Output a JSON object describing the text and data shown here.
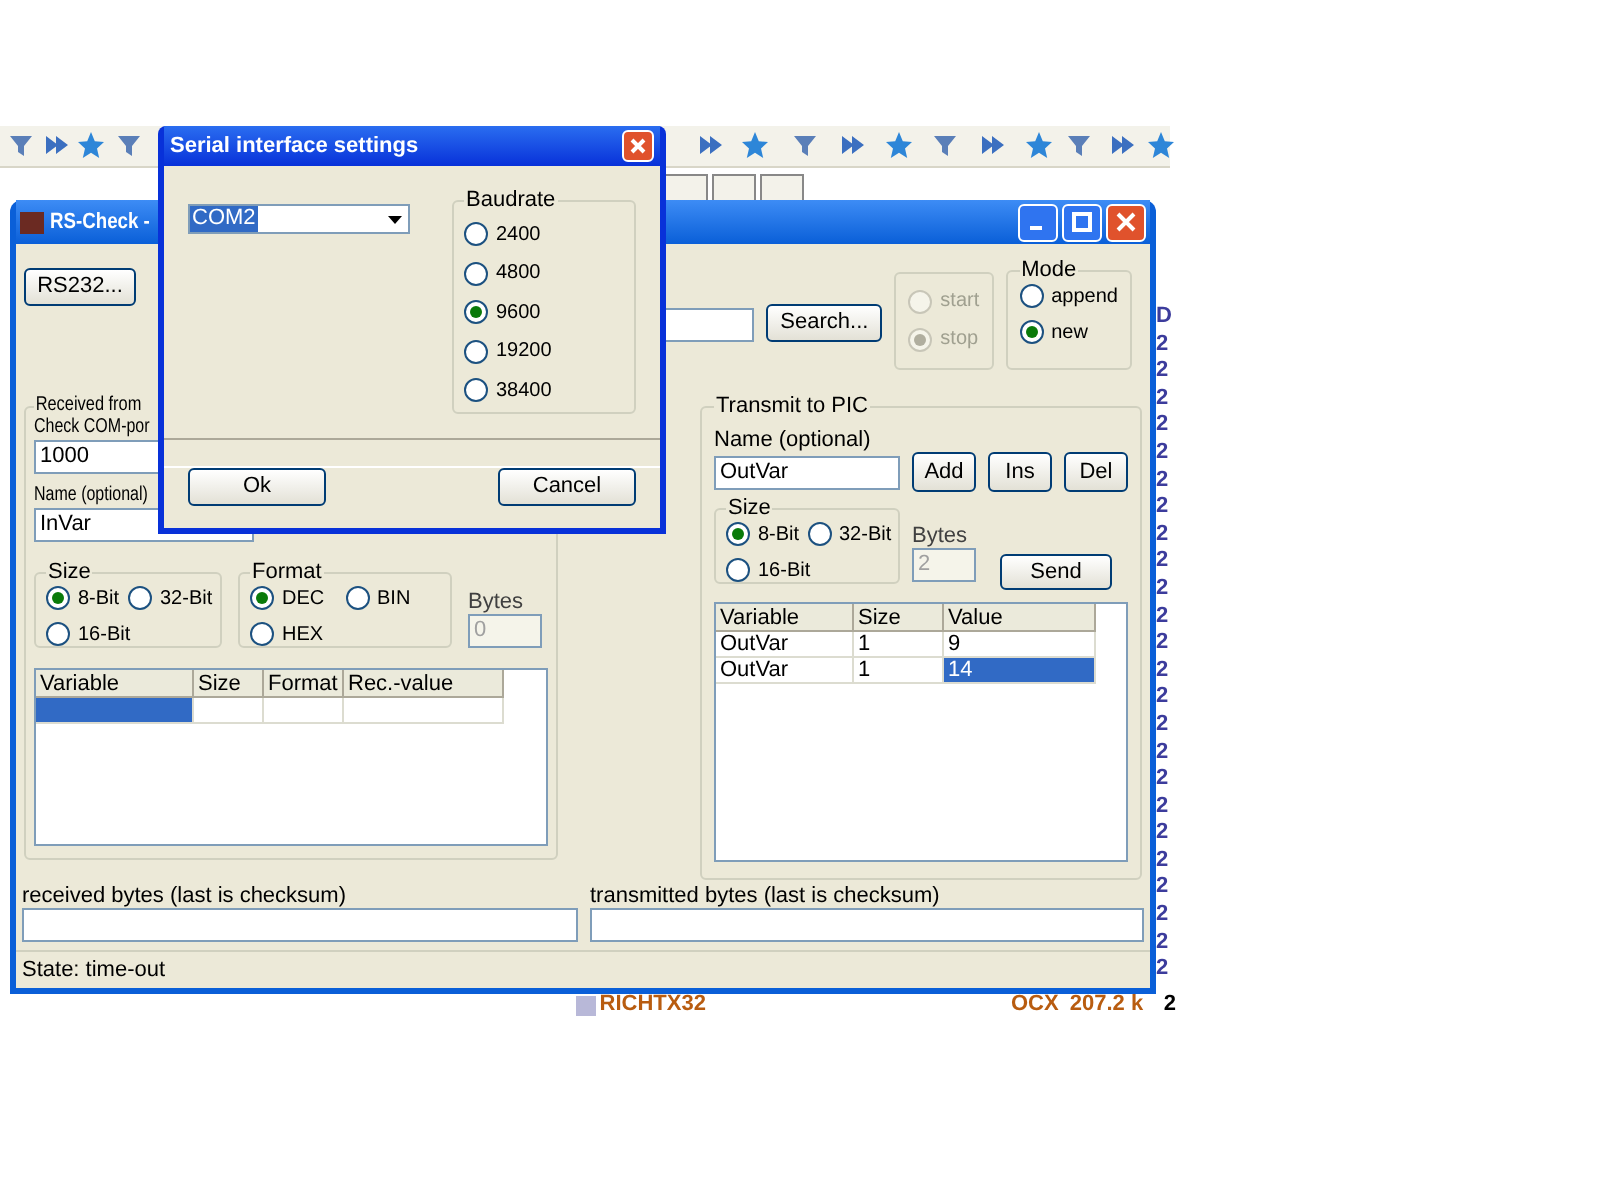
{
  "background_app": {
    "right_column": [
      "D",
      "2",
      "2",
      "2",
      "2",
      "2",
      "2",
      "2",
      "2",
      "2",
      "2",
      "2",
      "2",
      "2",
      "2",
      "2",
      "2",
      "2",
      "2",
      "2",
      "2",
      "2",
      "2",
      "2",
      "2"
    ],
    "file_row": {
      "name": "RICHTX32",
      "type": "OCX",
      "size": "207.2 k",
      "column_4": "2"
    }
  },
  "main_window": {
    "title": "RS-Check -",
    "rs232_button": "RS232...",
    "search_button": "Search...",
    "run_options": [
      {
        "label": "start",
        "selected": false,
        "disabled": true
      },
      {
        "label": "stop",
        "selected": true,
        "disabled": true
      }
    ],
    "mode": {
      "title": "Mode",
      "options": [
        {
          "label": "append",
          "selected": false
        },
        {
          "label": "new",
          "selected": true
        }
      ]
    },
    "received": {
      "title": "Received from",
      "check_label": "Check COM-por",
      "check_value": "1000",
      "name_label": "Name (optional)",
      "name_value": "InVar",
      "size": {
        "title": "Size",
        "options": [
          {
            "label": "8-Bit",
            "selected": true
          },
          {
            "label": "32-Bit",
            "selected": false
          },
          {
            "label": "16-Bit",
            "selected": false
          }
        ]
      },
      "format": {
        "title": "Format",
        "options": [
          {
            "label": "DEC",
            "selected": true
          },
          {
            "label": "BIN",
            "selected": false
          },
          {
            "label": "HEX",
            "selected": false
          }
        ]
      },
      "bytes": {
        "label": "Bytes",
        "value": "0",
        "disabled": true
      },
      "table": {
        "columns": [
          "Variable",
          "Size",
          "Format",
          "Rec.-value"
        ],
        "rows": [
          {
            "cells": [
              "",
              "",
              "",
              ""
            ],
            "selected": true
          }
        ]
      }
    },
    "transmit": {
      "title": "Transmit to PIC",
      "name_label": "Name (optional)",
      "name_value": "OutVar",
      "buttons": [
        "Add",
        "Ins",
        "Del"
      ],
      "size": {
        "title": "Size",
        "options": [
          {
            "label": "8-Bit",
            "selected": true
          },
          {
            "label": "32-Bit",
            "selected": false
          },
          {
            "label": "16-Bit",
            "selected": false
          }
        ]
      },
      "bytes": {
        "label": "Bytes",
        "value": "2",
        "disabled": true
      },
      "send_button": "Send",
      "table": {
        "columns": [
          "Variable",
          "Size",
          "Value"
        ],
        "rows": [
          {
            "cells": [
              "OutVar",
              "1",
              "9"
            ],
            "selected": false
          },
          {
            "cells": [
              "OutVar",
              "1",
              "14"
            ],
            "selected": true
          }
        ]
      }
    },
    "received_bytes": {
      "label": "received bytes (last is checksum)"
    },
    "transmitted_bytes": {
      "label": "transmitted bytes (last is checksum)"
    },
    "status": "State: time-out"
  },
  "dialog": {
    "title": "Serial interface settings",
    "port": "COM2",
    "baudrate": {
      "title": "Baudrate",
      "options": [
        {
          "label": "2400",
          "selected": false
        },
        {
          "label": "4800",
          "selected": false
        },
        {
          "label": "9600",
          "selected": true
        },
        {
          "label": "19200",
          "selected": false
        },
        {
          "label": "38400",
          "selected": false
        }
      ]
    },
    "buttons": [
      "Ok",
      "Cancel"
    ]
  }
}
